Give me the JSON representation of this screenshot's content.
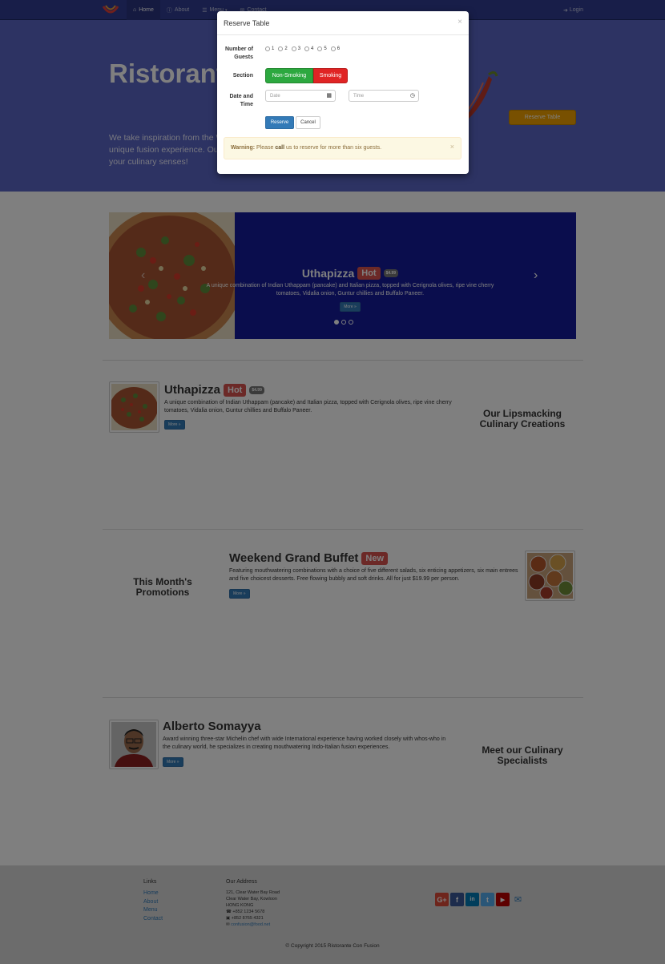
{
  "navbar": {
    "items": [
      {
        "label": "Home",
        "icon": "home-icon"
      },
      {
        "label": "About",
        "icon": "info-icon"
      },
      {
        "label": "Menu",
        "icon": "list-icon"
      },
      {
        "label": "Contact",
        "icon": "envelope-icon"
      }
    ],
    "login": "Login"
  },
  "jumbotron": {
    "title": "Ristorante con Fusion",
    "text": "We take inspiration from the World's best cuisines, and create a unique fusion experience. Our lipsmacking creations will tickle your culinary senses!",
    "reserve_button": "Reserve Table"
  },
  "carousel": {
    "title": "Uthapizza",
    "badge": "Hot",
    "price": "$4.99",
    "description": "A unique combination of Indian Uthappam (pancake) and Italian pizza, topped with Cerignola olives, ripe vine cherry tomatoes, Vidalia onion, Guntur chillies and Buffalo Paneer.",
    "more": "More »"
  },
  "dish": {
    "title": "Uthapizza",
    "badge": "Hot",
    "price": "$4.99",
    "description": "A unique combination of Indian Uthappam (pancake) and Italian pizza, topped with Cerignola olives, ripe vine cherry tomatoes, Vidalia onion, Guntur chillies and Buffalo Paneer.",
    "more": "More »",
    "side_heading": "Our Lipsmacking Culinary Creations"
  },
  "promotion": {
    "title": "Weekend Grand Buffet",
    "badge": "New",
    "description": "Featuring mouthwatering combinations with a choice of five different salads, six enticing appetizers, six main entrees and five choicest desserts. Free flowing bubbly and soft drinks. All for just $19.99 per person.",
    "more": "More »",
    "side_heading": "This Month's Promotions"
  },
  "leader": {
    "name": "Alberto Somayya",
    "description": "Award winning three-star Michelin chef with wide International experience having worked closely with whos-who in the culinary world, he specializes in creating mouthwatering Indo-Italian fusion experiences.",
    "more": "More »",
    "side_heading": "Meet our Culinary Specialists"
  },
  "footer": {
    "links_heading": "Links",
    "links": [
      "Home",
      "About",
      "Menu",
      "Contact"
    ],
    "address_heading": "Our Address",
    "address_lines": [
      "121, Clear Water Bay Road",
      "Clear Water Bay, Kowloon",
      "HONG KONG"
    ],
    "phone": "+852 1234 5678",
    "fax": "+852 8765 4321",
    "email": "confusion@food.net",
    "social": [
      {
        "name": "google-plus-icon",
        "glyph": "G+",
        "color": "#dd4b39"
      },
      {
        "name": "facebook-icon",
        "glyph": "f",
        "color": "#3b5998"
      },
      {
        "name": "linkedin-icon",
        "glyph": "in",
        "color": "#007bb6"
      },
      {
        "name": "twitter-icon",
        "glyph": "t",
        "color": "#55acee"
      },
      {
        "name": "youtube-icon",
        "glyph": "▶",
        "color": "#bb0000"
      }
    ],
    "copyright": "© Copyright 2015 Ristorante Con Fusion"
  },
  "modal": {
    "title": "Reserve Table",
    "guests_label": "Number of Guests",
    "guest_options": [
      "1",
      "2",
      "3",
      "4",
      "5",
      "6"
    ],
    "section_label": "Section",
    "section_options": [
      "Non-Smoking",
      "Smoking"
    ],
    "datetime_label": "Date and Time",
    "date_placeholder": "Date",
    "time_placeholder": "Time",
    "reserve_button": "Reserve",
    "cancel_button": "Cancel",
    "warning_strong": "Warning:",
    "warning_pre": "Please",
    "warning_call": "call",
    "warning_post": "us to reserve for more than six guests."
  },
  "colors": {
    "navbar": "#303d92",
    "jumbotron": "#5a66c6",
    "accent": "#f0a000",
    "non_smoking": "#2ca83f",
    "smoking": "#e02424"
  }
}
